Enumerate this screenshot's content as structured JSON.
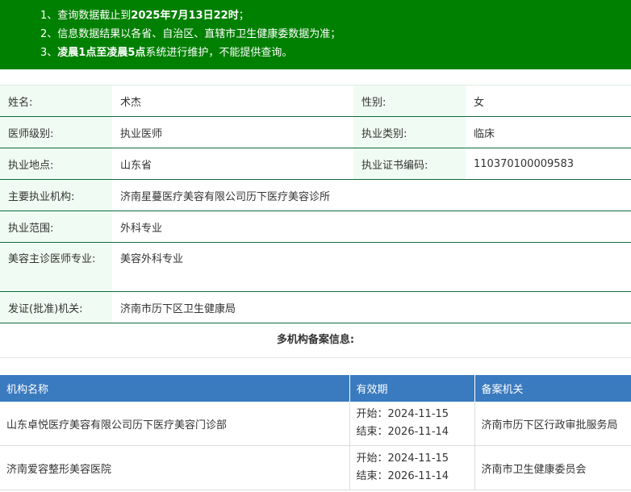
{
  "notice": {
    "line1_pre": "1、查询数据截止到",
    "line1_bold": "2025年7月13日22时",
    "line1_post": "；",
    "line2": "2、信息数据结果以各省、自治区、直辖市卫生健康委数据为准；",
    "line3_pre": "3、",
    "line3_bold": "凌晨1点至凌晨5点",
    "line3_post": "系统进行维护，不能提供查询。"
  },
  "info": {
    "name_label": "姓名:",
    "name_value": "术杰",
    "gender_label": "性别:",
    "gender_value": "女",
    "level_label": "医师级别:",
    "level_value": "执业医师",
    "category_label": "执业类别:",
    "category_value": "临床",
    "location_label": "执业地点:",
    "location_value": "山东省",
    "cert_label": "执业证书编码:",
    "cert_value": "110370100009583",
    "org_label": "主要执业机构:",
    "org_value": "济南星蔓医疗美容有限公司历下医疗美容诊所",
    "scope_label": "执业范围:",
    "scope_value": "外科专业",
    "cosmetic_label": "美容主诊医师专业:",
    "cosmetic_value": "美容外科专业",
    "issuer_label": "发证(批准)机关:",
    "issuer_value": "济南市历下区卫生健康局"
  },
  "multi": {
    "title": "多机构备案信息:",
    "headers": [
      "机构名称",
      "有效期",
      "备案机关"
    ],
    "rows": [
      {
        "name": "山东卓悦医疗美容有限公司历下医疗美容门诊部",
        "start": "开始：2024-11-15",
        "end": "结束：2026-11-14",
        "authority": "济南市历下区行政审批服务局"
      },
      {
        "name": "济南爱容整形美容医院",
        "start": "开始：2024-11-15",
        "end": "结束：2026-11-14",
        "authority": "济南市卫生健康委员会"
      }
    ]
  }
}
